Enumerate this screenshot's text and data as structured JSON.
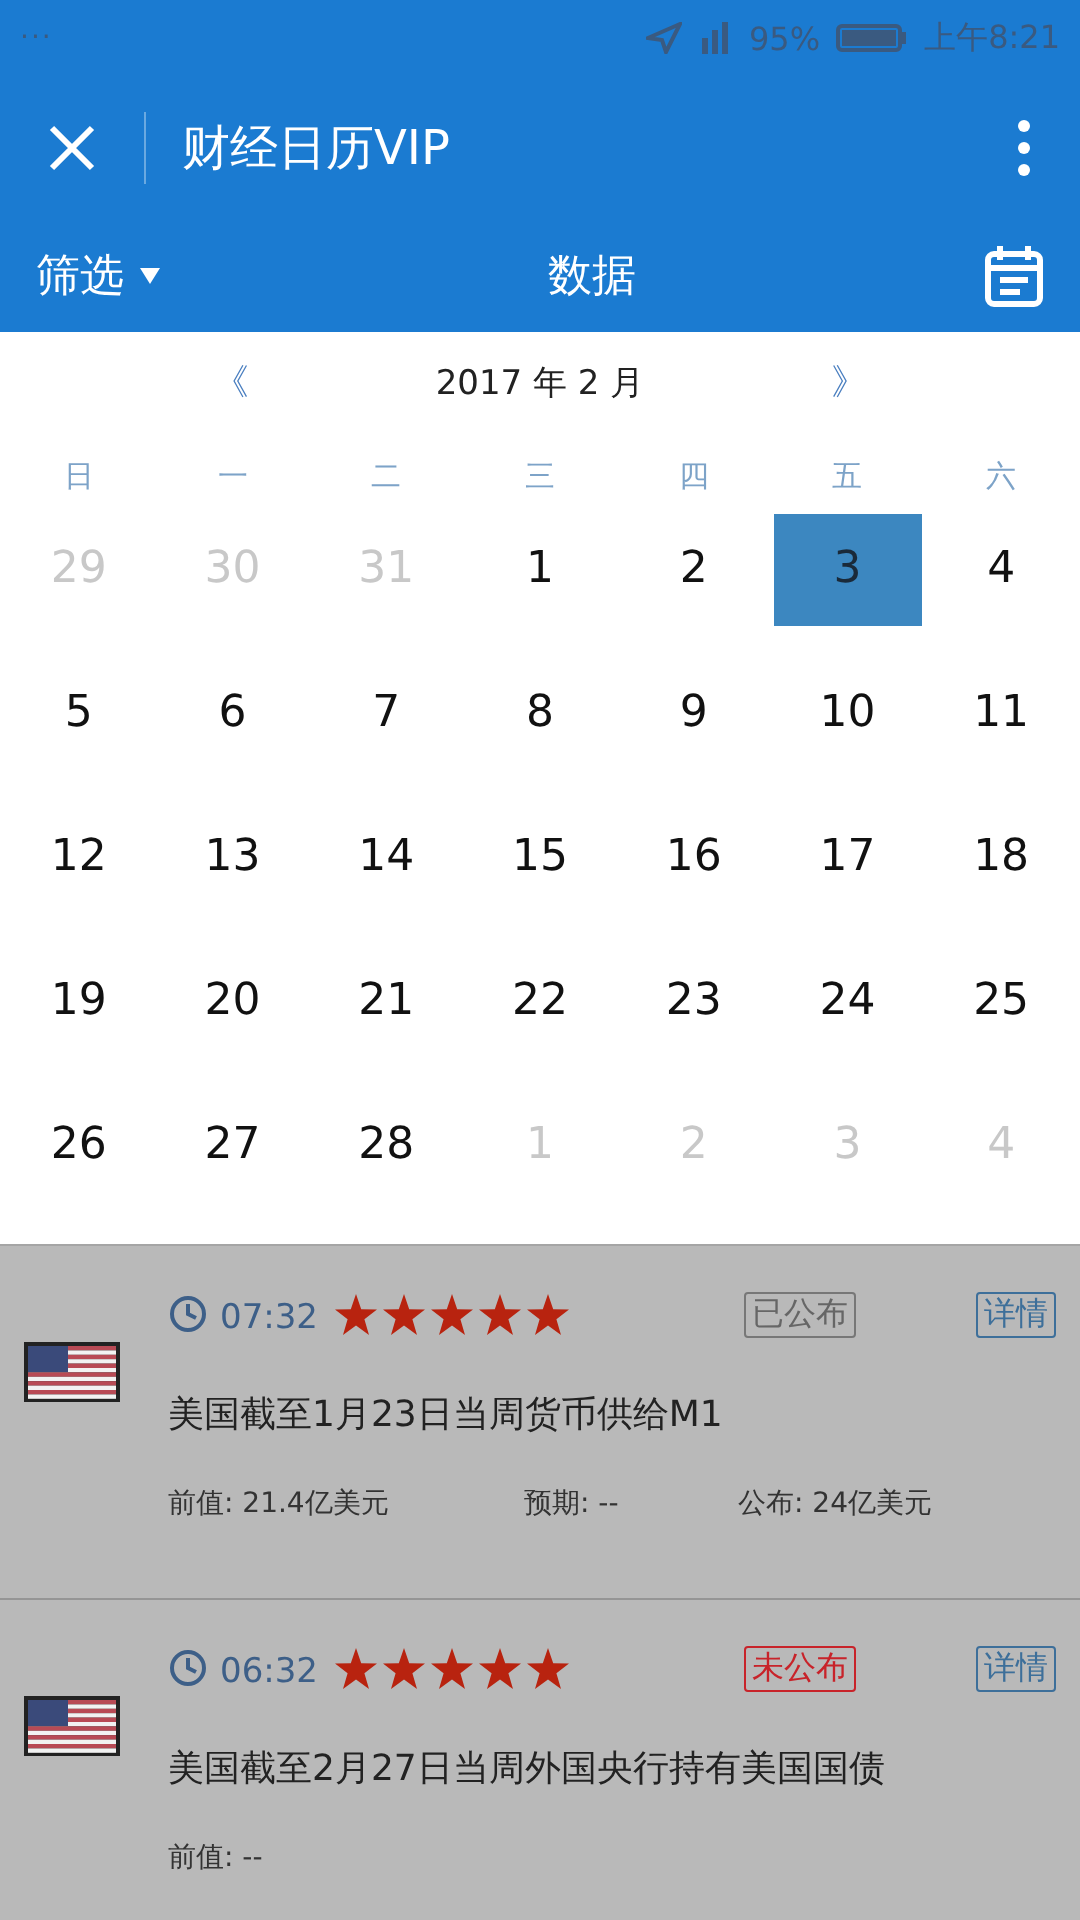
{
  "status_bar": {
    "dots": "···",
    "battery": "95%",
    "time": "上午8:21"
  },
  "title_bar": {
    "title": "财经日历VIP"
  },
  "toolbar": {
    "filter": "筛选",
    "title": "数据"
  },
  "calendar": {
    "prev": "《",
    "month": "2017 年 2 月",
    "next": "》",
    "weekdays": [
      "日",
      "一",
      "二",
      "三",
      "四",
      "五",
      "六"
    ],
    "days": [
      {
        "label": "29",
        "muted": true,
        "selected": false
      },
      {
        "label": "30",
        "muted": true,
        "selected": false
      },
      {
        "label": "31",
        "muted": true,
        "selected": false
      },
      {
        "label": "1",
        "muted": false,
        "selected": false
      },
      {
        "label": "2",
        "muted": false,
        "selected": false
      },
      {
        "label": "3",
        "muted": false,
        "selected": true
      },
      {
        "label": "4",
        "muted": false,
        "selected": false
      },
      {
        "label": "5",
        "muted": false,
        "selected": false
      },
      {
        "label": "6",
        "muted": false,
        "selected": false
      },
      {
        "label": "7",
        "muted": false,
        "selected": false
      },
      {
        "label": "8",
        "muted": false,
        "selected": false
      },
      {
        "label": "9",
        "muted": false,
        "selected": false
      },
      {
        "label": "10",
        "muted": false,
        "selected": false
      },
      {
        "label": "11",
        "muted": false,
        "selected": false
      },
      {
        "label": "12",
        "muted": false,
        "selected": false
      },
      {
        "label": "13",
        "muted": false,
        "selected": false
      },
      {
        "label": "14",
        "muted": false,
        "selected": false
      },
      {
        "label": "15",
        "muted": false,
        "selected": false
      },
      {
        "label": "16",
        "muted": false,
        "selected": false
      },
      {
        "label": "17",
        "muted": false,
        "selected": false
      },
      {
        "label": "18",
        "muted": false,
        "selected": false
      },
      {
        "label": "19",
        "muted": false,
        "selected": false
      },
      {
        "label": "20",
        "muted": false,
        "selected": false
      },
      {
        "label": "21",
        "muted": false,
        "selected": false
      },
      {
        "label": "22",
        "muted": false,
        "selected": false
      },
      {
        "label": "23",
        "muted": false,
        "selected": false
      },
      {
        "label": "24",
        "muted": false,
        "selected": false
      },
      {
        "label": "25",
        "muted": false,
        "selected": false
      },
      {
        "label": "26",
        "muted": false,
        "selected": false
      },
      {
        "label": "27",
        "muted": false,
        "selected": false
      },
      {
        "label": "28",
        "muted": false,
        "selected": false
      },
      {
        "label": "1",
        "muted": true,
        "selected": false
      },
      {
        "label": "2",
        "muted": true,
        "selected": false
      },
      {
        "label": "3",
        "muted": true,
        "selected": false
      },
      {
        "label": "4",
        "muted": true,
        "selected": false
      }
    ]
  },
  "events": [
    {
      "time": "07:32",
      "stars": 5,
      "status": "已公布",
      "released": true,
      "detail": "详情",
      "title": "美国截至1月23日当周货币供给M1",
      "previous": "前值: 21.4亿美元",
      "forecast": "预期: --",
      "actual": "公布: 24亿美元"
    },
    {
      "time": "06:32",
      "stars": 5,
      "status": "未公布",
      "released": false,
      "detail": "详情",
      "title": "美国截至2月27日当周外国央行持有美国国债",
      "previous": "前值: --"
    }
  ]
}
